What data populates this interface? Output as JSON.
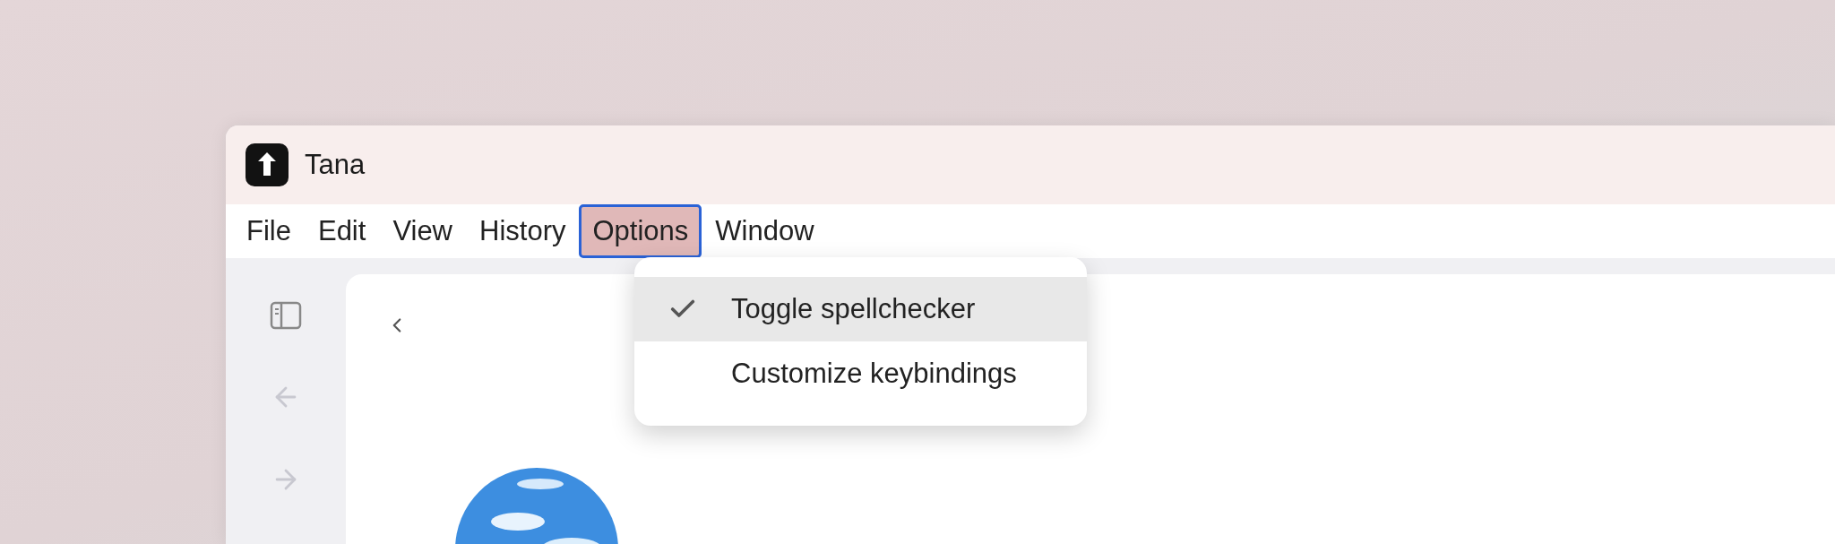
{
  "window": {
    "title": "Tana"
  },
  "menu_bar": [
    {
      "label": "File",
      "selected": false
    },
    {
      "label": "Edit",
      "selected": false
    },
    {
      "label": "View",
      "selected": false
    },
    {
      "label": "History",
      "selected": false
    },
    {
      "label": "Options",
      "selected": true
    },
    {
      "label": "Window",
      "selected": false
    }
  ],
  "dropdown": [
    {
      "label": "Toggle spellchecker",
      "checked": true,
      "selected": true
    },
    {
      "label": "Customize keybindings",
      "checked": false,
      "selected": false
    }
  ]
}
